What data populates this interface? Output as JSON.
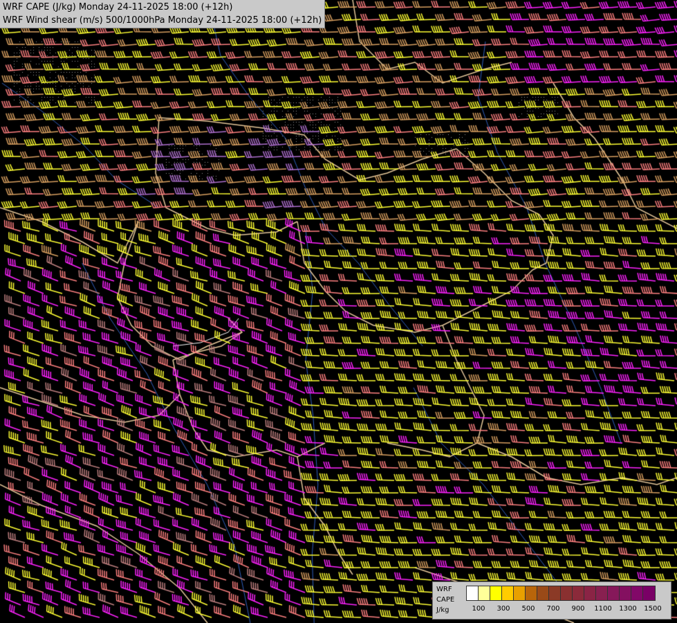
{
  "header": {
    "line1": "WRF CAPE (J/kg) Monday 24-11-2025 18:00 (+12h)",
    "line2": "WRF Wind shear (m/s) 500/1000hPa Monday 24-11-2025 18:00 (+12h)"
  },
  "legend": {
    "model": "WRF",
    "variable": "CAPE",
    "unit": "J/kg",
    "colors": [
      "#ffffff",
      "#ffff99",
      "#ffff00",
      "#ffcc00",
      "#e8a000",
      "#b8650a",
      "#9a4a18",
      "#8b3a26",
      "#8a3030",
      "#8b2a3a",
      "#8a2445",
      "#882050",
      "#86185a",
      "#841060",
      "#820868",
      "#7a0066"
    ],
    "tick_labels": [
      "100",
      "300",
      "500",
      "700",
      "900",
      "1100",
      "1300",
      "1500"
    ]
  },
  "map": {
    "barb_colors": {
      "yellow": "#ffff33",
      "magenta": "#ff22ff",
      "salmon": "#ff8080",
      "tan": "#d9a060",
      "violet": "#b070d0",
      "mauve": "#c08080"
    },
    "border_color": "#e6c89a",
    "river_color": "#3060c0"
  }
}
